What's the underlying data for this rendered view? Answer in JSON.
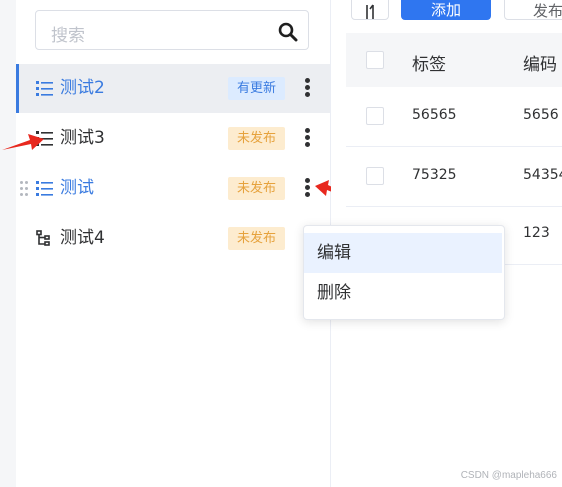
{
  "search": {
    "placeholder": "搜索"
  },
  "sidebar": {
    "items": [
      {
        "label": "测试2",
        "badge": "有更新",
        "badge_color": "#3a7be0",
        "active": true
      },
      {
        "label": "测试3",
        "badge": "未发布",
        "badge_color": "#e6a23c"
      },
      {
        "label": "测试",
        "badge": "未发布",
        "badge_color": "#e6a23c"
      },
      {
        "label": "测试4",
        "badge": "未发布",
        "badge_color": "#e6a23c"
      }
    ]
  },
  "toolbar": {
    "add_label": "添加",
    "publish_label": "发布"
  },
  "table": {
    "columns": [
      "标签",
      "编码"
    ],
    "rows": [
      {
        "tag": "56565",
        "code": "5656"
      },
      {
        "tag": "75325",
        "code": "54354"
      },
      {
        "tag": "",
        "code": "123"
      }
    ]
  },
  "context_menu": {
    "items": [
      "编辑",
      "删除"
    ]
  },
  "watermark": "CSDN @mapleha666",
  "colors": {
    "accent": "#2f76f0",
    "active_text": "#3a7be0",
    "annotation_arrow": "#e8281e"
  }
}
